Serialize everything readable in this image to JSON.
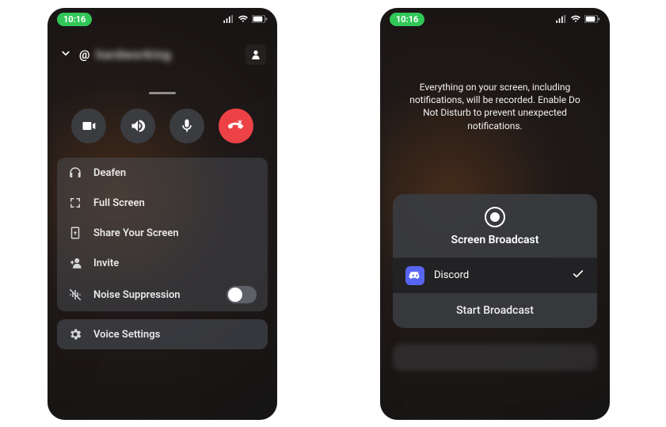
{
  "status": {
    "time": "10:16"
  },
  "screen1": {
    "channel_prefix": "@",
    "channel_name": "hardworking",
    "menu": {
      "deafen": "Deafen",
      "fullscreen": "Full Screen",
      "share_screen": "Share Your Screen",
      "invite": "Invite",
      "noise_suppression": "Noise Suppression",
      "voice_settings": "Voice Settings"
    },
    "noise_suppression_on": false
  },
  "screen2": {
    "disclaimer": "Everything on your screen, including notifications, will be recorded. Enable Do Not Disturb to prevent unexpected notifications.",
    "broadcast": {
      "title": "Screen Broadcast",
      "app_name": "Discord",
      "start_label": "Start Broadcast"
    }
  }
}
